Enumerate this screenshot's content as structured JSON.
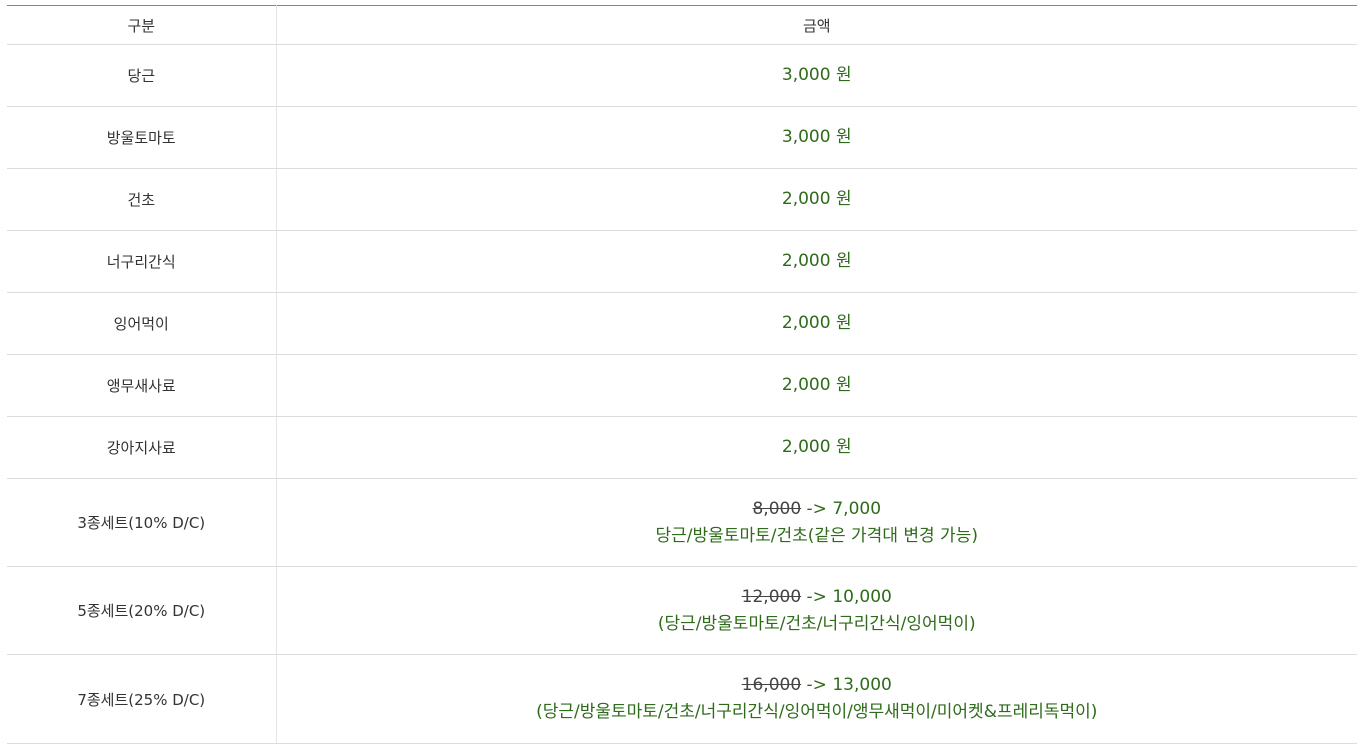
{
  "table": {
    "headers": {
      "name": "구분",
      "price": "금액"
    },
    "items": [
      {
        "name": "당근",
        "price": "3,000 원"
      },
      {
        "name": "방울토마토",
        "price": "3,000 원"
      },
      {
        "name": "건초",
        "price": "2,000 원"
      },
      {
        "name": "너구리간식",
        "price": "2,000 원"
      },
      {
        "name": "잉어먹이",
        "price": "2,000 원"
      },
      {
        "name": "앵무새사료",
        "price": "2,000 원"
      },
      {
        "name": "강아지사료",
        "price": "2,000 원"
      }
    ],
    "sets": [
      {
        "name": "3종세트(10% D/C)",
        "old_price": "8,000",
        "arrow": "->",
        "new_price": "7,000",
        "contents": "당근/방울토마토/건초(같은 가격대 변경 가능)"
      },
      {
        "name": "5종세트(20% D/C)",
        "old_price": "12,000",
        "arrow": "->",
        "new_price": "10,000",
        "contents": "(당근/방울토마토/건초/너구리간식/잉어먹이)"
      },
      {
        "name": "7종세트(25% D/C)",
        "old_price": "16,000",
        "arrow": "->",
        "new_price": "13,000",
        "contents": "(당근/방울토마토/건초/너구리간식/잉어먹이/앵무새먹이/미어켓&프레리독먹이)"
      }
    ]
  },
  "colors": {
    "price_text": "#2e6b1a",
    "strike_text": "#444444",
    "header_border": "#8a8a5c"
  }
}
